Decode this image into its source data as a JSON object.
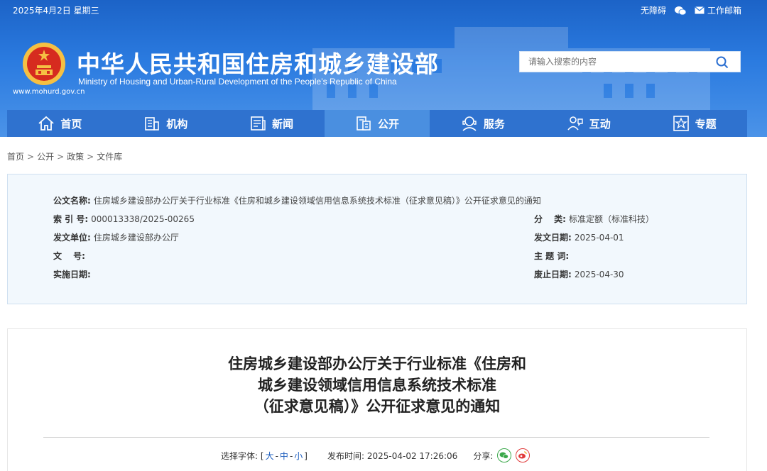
{
  "topbar": {
    "date": "2025年4月2日 星期三",
    "accessibility": "无障碍",
    "mail": "工作邮箱"
  },
  "header": {
    "title": "中华人民共和国住房和城乡建设部",
    "subtitle": "Ministry of Housing and Urban-Rural Development of the People’s Republic of China",
    "url": "www.mohurd.gov.cn"
  },
  "search": {
    "placeholder": "请输入搜索的内容"
  },
  "nav": {
    "items": [
      {
        "label": "首页",
        "icon": "home-icon"
      },
      {
        "label": "机构",
        "icon": "building-icon"
      },
      {
        "label": "新闻",
        "icon": "news-icon"
      },
      {
        "label": "公开",
        "icon": "document-icon"
      },
      {
        "label": "服务",
        "icon": "service-icon"
      },
      {
        "label": "互动",
        "icon": "interaction-icon"
      },
      {
        "label": "专题",
        "icon": "star-icon"
      }
    ],
    "active": "公开"
  },
  "breadcrumb": [
    "首页",
    "公开",
    "政策",
    "文件库"
  ],
  "meta": {
    "doc_name_label": "公文名称:",
    "doc_name": "住房城乡建设部办公厅关于行业标准《住房和城乡建设领域信用信息系统技术标准（征求意见稿）》公开征求意见的通知",
    "index_label": "索 引 号:",
    "index": "000013338/2025-00265",
    "category_label": "分　 类:",
    "category": "标准定额（标准科技）",
    "issuer_label": "发文单位:",
    "issuer": "住房城乡建设部办公厅",
    "issue_date_label": "发文日期:",
    "issue_date": "2025-04-01",
    "doc_no_label": "文　 号:",
    "doc_no": "",
    "keywords_label": "主 题 词:",
    "keywords": "",
    "effective_label": "实施日期:",
    "effective": "",
    "expire_label": "废止日期:",
    "expire": "2025-04-30"
  },
  "article": {
    "title_lines": [
      "住房城乡建设部办公厅关于行业标准《住房和",
      "城乡建设领域信用信息系统技术标准",
      "（征求意见稿）》公开征求意见的通知"
    ],
    "font_label": "选择字体:",
    "font_large": "大",
    "font_medium": "中",
    "font_small": "小",
    "publish_label": "发布时间:",
    "publish_time": "2025-04-02 17:26:06",
    "share_label": "分享:"
  },
  "colors": {
    "header_blue": "#1c63c7",
    "nav_blue": "#2f72cf",
    "nav_active": "#4a8fe0",
    "emblem_red": "#d62b1f",
    "emblem_gold": "#f5c043"
  }
}
